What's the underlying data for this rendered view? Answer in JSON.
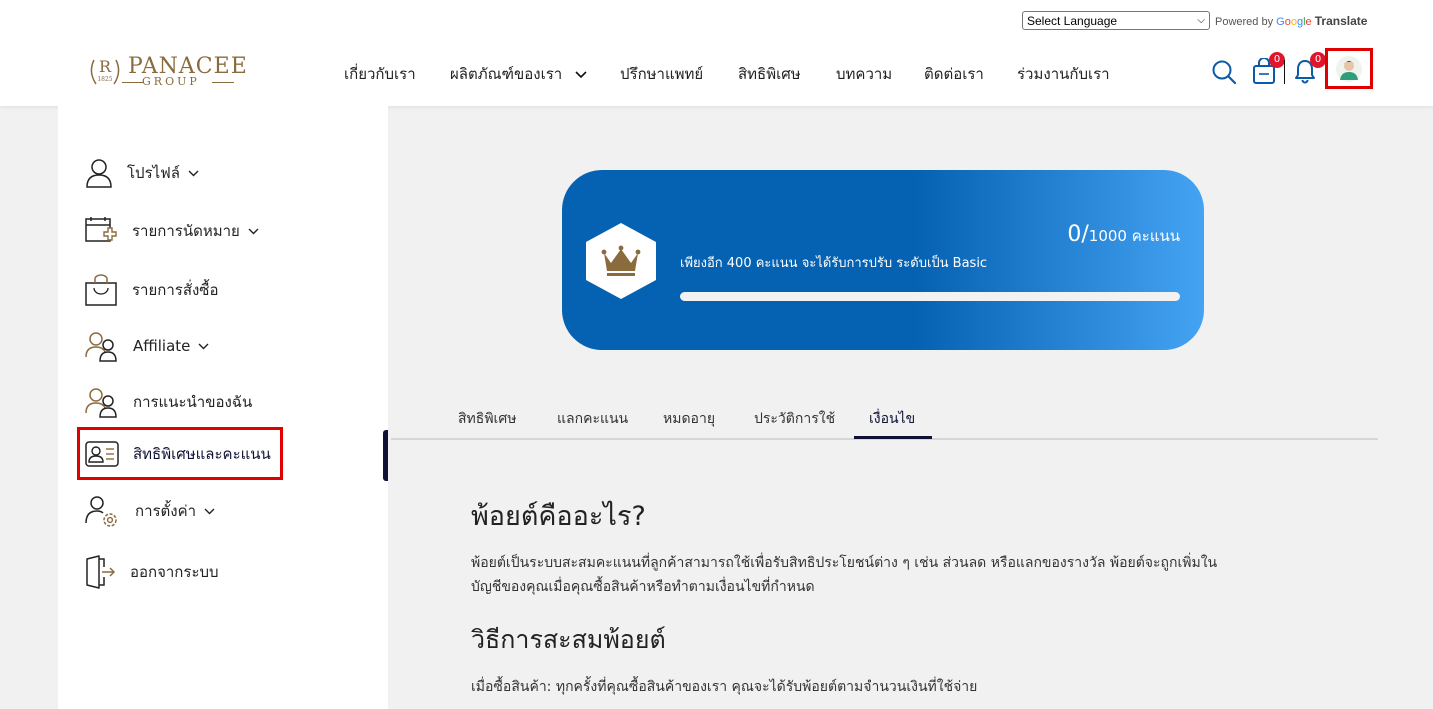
{
  "translate": {
    "select_label": "Select Language",
    "powered_by": "Powered by",
    "google": [
      "G",
      "o",
      "o",
      "g",
      "l",
      "e"
    ],
    "translate_label": "Translate"
  },
  "brand": {
    "name": "PANACEE",
    "group": "GROUP",
    "mark": "R",
    "year": "1825",
    "color": "#8a6b3e"
  },
  "nav": {
    "items": [
      {
        "label": "เกี่ยวกับเรา"
      },
      {
        "label": "ผลิตภัณฑ์ของเรา"
      },
      {
        "label": "ปรึกษาแพทย์"
      },
      {
        "label": "สิทธิพิเศษ"
      },
      {
        "label": "บทความ"
      },
      {
        "label": "ติดต่อเรา"
      },
      {
        "label": "ร่วมงานกับเรา"
      }
    ]
  },
  "header": {
    "cart_count": "0",
    "notification_count": "0"
  },
  "sidebar": {
    "items": [
      {
        "label": "โปรไฟล์",
        "icon": "user-icon"
      },
      {
        "label": "รายการนัดหมาย",
        "icon": "calendar-plus-icon"
      },
      {
        "label": "รายการสั่งซื้อ",
        "icon": "shopping-bag-icon"
      },
      {
        "label": "Affiliate",
        "icon": "users-icon"
      },
      {
        "label": "การแนะนำของฉัน",
        "icon": "users-icon"
      },
      {
        "label": "สิทธิพิเศษและคะแนน",
        "icon": "id-card-icon"
      },
      {
        "label": "การตั้งค่า",
        "icon": "user-gear-icon"
      },
      {
        "label": "ออกจากระบบ",
        "icon": "logout-icon"
      }
    ],
    "active_index": 5
  },
  "points_card": {
    "current": "0/",
    "target": "1000 คะแนน",
    "message": "เพียงอีก 400 คะแนน จะได้รับการปรับ ระดับเป็น Basic",
    "progress": 0,
    "gradient_start": "#0561b1",
    "gradient_end": "#45a3f4",
    "crown_color": "#8a6b3e"
  },
  "tabs": {
    "items": [
      {
        "label": "สิทธิพิเศษ"
      },
      {
        "label": "แลกคะแนน"
      },
      {
        "label": "หมดอายุ"
      },
      {
        "label": "ประวัติการใช้"
      },
      {
        "label": "เงื่อนไข"
      }
    ],
    "active_index": 4
  },
  "content": {
    "heading1": "พ้อยต์คืออะไร?",
    "para1_line1": "พ้อยต์เป็นระบบสะสมคะแนนที่ลูกค้าสามารถใช้เพื่อรับสิทธิประโยชน์ต่าง ๆ เช่น ส่วนลด หรือแลกของรางวัล พ้อยต์จะถูกเพิ่มใน",
    "para1_line2": "บัญชีของคุณเมื่อคุณซื้อสินค้าหรือทำตามเงื่อนไขที่กำหนด",
    "heading2": "วิธีการสะสมพ้อยต์",
    "para2": "เมื่อซื้อสินค้า: ทุกครั้งที่คุณซื้อสินค้าของเรา คุณจะได้รับพ้อยต์ตามจำนวนเงินที่ใช้จ่าย"
  }
}
